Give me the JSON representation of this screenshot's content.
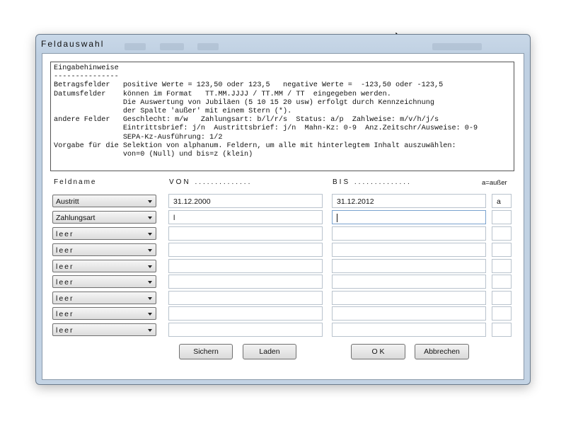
{
  "window": {
    "title": "Feldauswahl"
  },
  "hints": {
    "lines": [
      "Eingabehinweise",
      "---------------",
      "Betragsfelder   positive Werte = 123,50 oder 123,5   negative Werte =  -123,50 oder -123,5",
      "Datumsfelder    können im Format   TT.MM.JJJJ / TT.MM / TT  eingegeben werden.",
      "                Die Auswertung von Jubiläen (5 10 15 20 usw) erfolgt durch Kennzeichnung",
      "                der Spalte 'außer' mit einem Stern (*).",
      "andere Felder   Geschlecht: m/w   Zahlungsart: b/l/r/s  Status: a/p  Zahlweise: m/v/h/j/s",
      "                Eintrittsbrief: j/n  Austrittsbrief: j/n  Mahn-Kz: 0-9  Anz.Zeitschr/Ausweise: 0-9",
      "                SEPA-Kz-Ausführung: 1/2",
      "Vorgabe für die Selektion von alphanum. Feldern, um alle mit hinterlegtem Inhalt auszuwählen:",
      "                von=0 (Null) und bis=z (klein)"
    ]
  },
  "columns": {
    "feldname": "Feldname",
    "von": "VON ..............",
    "bis": "BIS ..............",
    "ausser": "a=außer"
  },
  "rows": [
    {
      "feld": "Austritt",
      "von": "31.12.2000",
      "bis": "31.12.2012",
      "ausser": "a"
    },
    {
      "feld": "Zahlungsart",
      "von": "l",
      "bis": "",
      "ausser": ""
    },
    {
      "feld": "leer",
      "von": "",
      "bis": "",
      "ausser": ""
    },
    {
      "feld": "leer",
      "von": "",
      "bis": "",
      "ausser": ""
    },
    {
      "feld": "leer",
      "von": "",
      "bis": "",
      "ausser": ""
    },
    {
      "feld": "leer",
      "von": "",
      "bis": "",
      "ausser": ""
    },
    {
      "feld": "leer",
      "von": "",
      "bis": "",
      "ausser": ""
    },
    {
      "feld": "leer",
      "von": "",
      "bis": "",
      "ausser": ""
    },
    {
      "feld": "leer",
      "von": "",
      "bis": "",
      "ausser": ""
    }
  ],
  "buttons": {
    "sichern": "Sichern",
    "laden": "Laden",
    "ok": "O K",
    "abbrechen": "Abbrechen"
  },
  "icons": {
    "cursor": "mouse-pointer-icon",
    "dropdown": "chevron-down-icon"
  }
}
